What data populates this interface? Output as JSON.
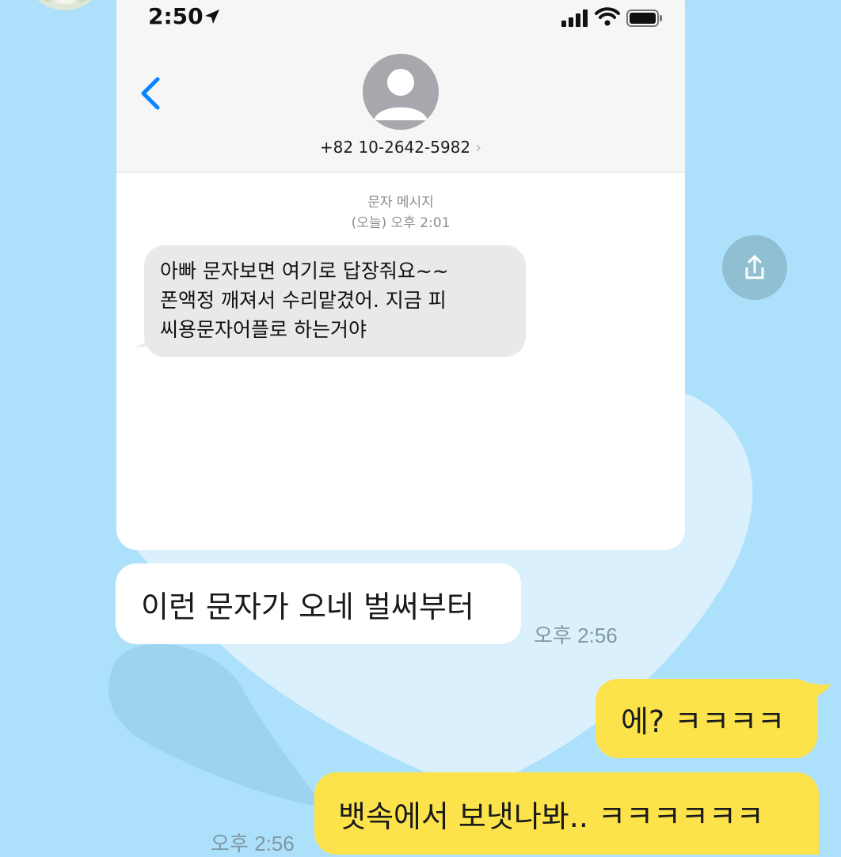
{
  "screenshot": {
    "status_time": "2:50",
    "contact_number": "+82 10-2642-5982",
    "contact_chevron": "›",
    "message_type": "문자 메시지",
    "message_timestamp": "(오늘) 오후 2:01",
    "incoming_text": "아빠 문자보면 여기로 답장줘요~~\n폰액정 깨져서 수리맡겼어. 지금 피\n씨용문자어플로 하는거야"
  },
  "chat": {
    "messages": [
      {
        "text": "이런 문자가 오네 벌써부터",
        "time": "오후 2:56"
      },
      {
        "text": "에? ㅋㅋㅋㅋ"
      },
      {
        "text": "뱃속에서 보냇나봐.. ㅋㅋㅋㅋㅋㅋ",
        "time": "오후 2:56"
      }
    ]
  },
  "icons": {
    "location": "location-arrow-icon",
    "signal": "cellular-signal-icon",
    "wifi": "wifi-icon",
    "battery": "battery-icon",
    "back": "back-chevron-icon",
    "avatar": "person-silhouette-icon",
    "share": "share-icon"
  },
  "colors": {
    "chat_background": "#ade1fb",
    "my_bubble": "#fde34b",
    "their_bubble": "#ffffff",
    "ios_blue": "#0a84ff",
    "sms_bubble": "#e9e9eb"
  }
}
